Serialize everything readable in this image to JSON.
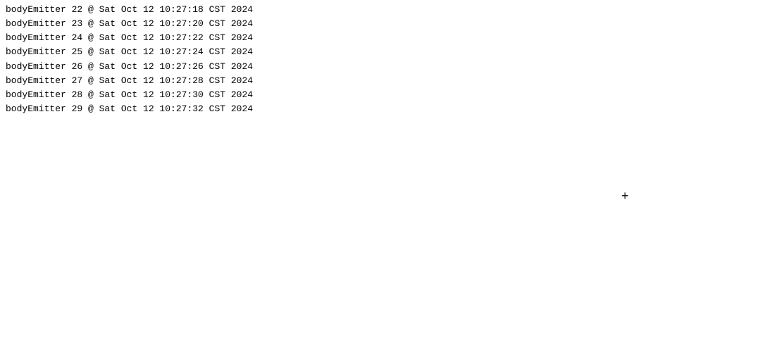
{
  "log": {
    "lines": [
      "bodyEmitter 22 @ Sat Oct 12 10:27:18 CST 2024",
      "bodyEmitter 23 @ Sat Oct 12 10:27:20 CST 2024",
      "bodyEmitter 24 @ Sat Oct 12 10:27:22 CST 2024",
      "bodyEmitter 25 @ Sat Oct 12 10:27:24 CST 2024",
      "bodyEmitter 26 @ Sat Oct 12 10:27:26 CST 2024",
      "bodyEmitter 27 @ Sat Oct 12 10:27:28 CST 2024",
      "bodyEmitter 28 @ Sat Oct 12 10:27:30 CST 2024",
      "bodyEmitter 29 @ Sat Oct 12 10:27:32 CST 2024"
    ],
    "plus_icon": "+"
  }
}
